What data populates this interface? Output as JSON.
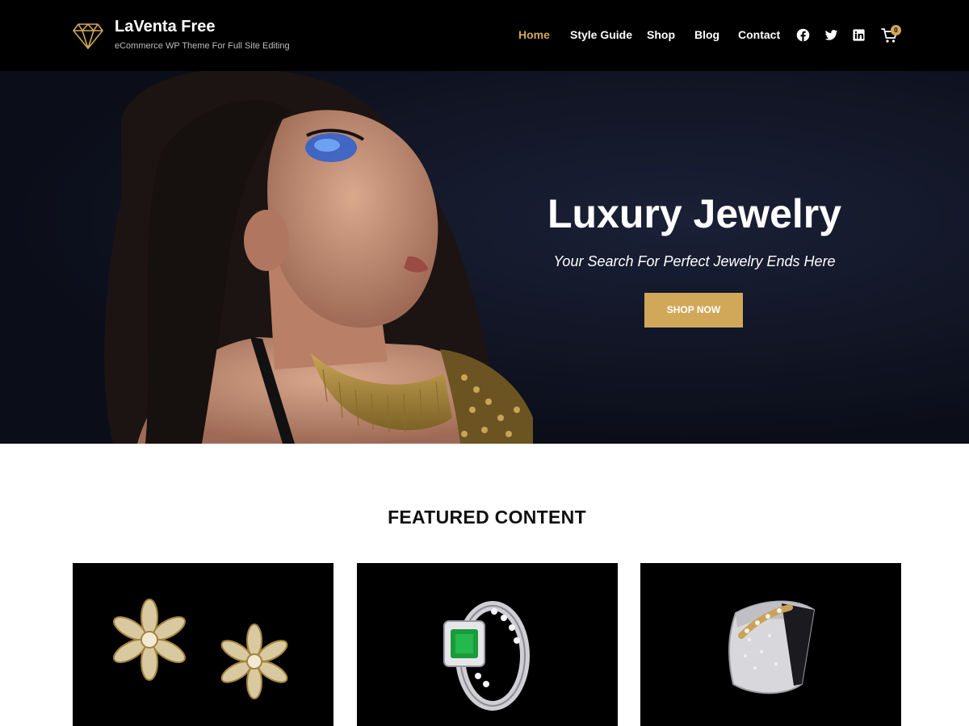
{
  "header": {
    "site_title": "LaVenta Free",
    "tagline": "eCommerce WP Theme For Full Site Editing",
    "logo_icon": "diamond-icon",
    "nav": [
      {
        "label": "Home",
        "active": true
      },
      {
        "label": "Style Guide",
        "active": false
      },
      {
        "label": "Shop",
        "active": false
      },
      {
        "label": "Blog",
        "active": false
      },
      {
        "label": "Contact",
        "active": false
      }
    ],
    "social_icons": [
      "facebook-icon",
      "twitter-icon",
      "linkedin-icon"
    ],
    "cart": {
      "icon": "cart-icon",
      "count": "0"
    }
  },
  "hero": {
    "title": "Luxury Jewelry",
    "subtitle": "Your Search For Perfect Jewelry Ends Here",
    "button_label": "SHOP NOW"
  },
  "featured": {
    "heading": "FEATURED CONTENT",
    "cards": [
      {
        "image": "gold-flower-earrings"
      },
      {
        "image": "emerald-diamond-ring"
      },
      {
        "image": "diamond-bracelet"
      }
    ]
  },
  "colors": {
    "accent": "#d1a85a",
    "header_bg": "#000000",
    "text_dark": "#111111"
  }
}
